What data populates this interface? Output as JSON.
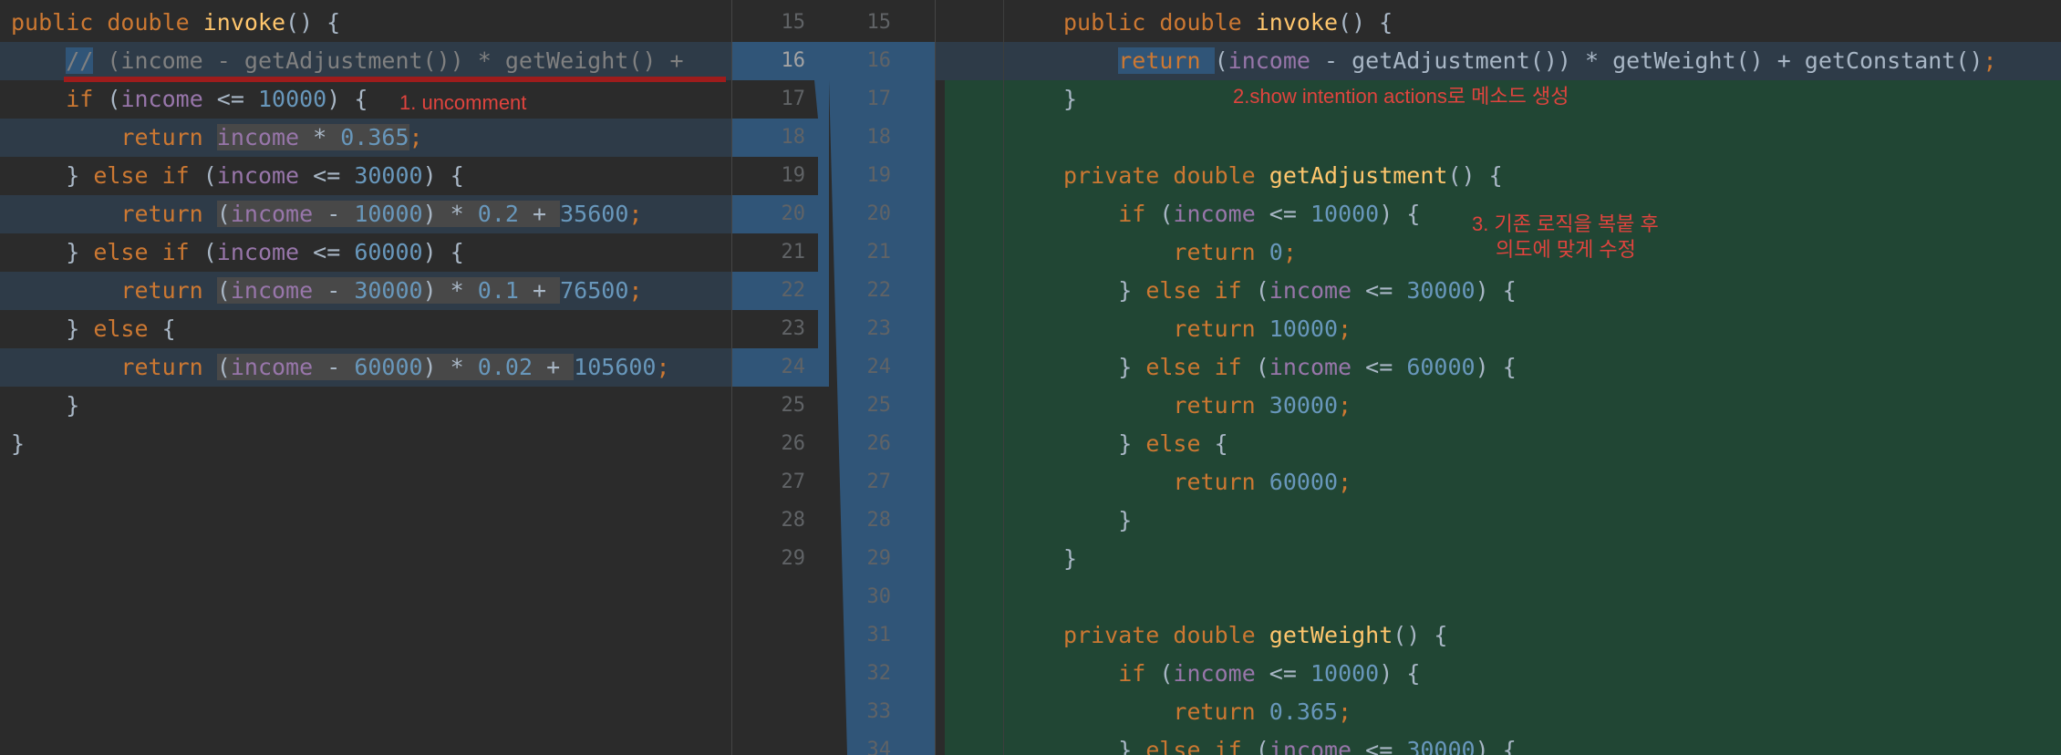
{
  "left": {
    "lines": [
      "public double invoke() {",
      "    // (income - getAdjustment()) * getWeight() +",
      "    if (income <= 10000) {",
      "        return income * 0.365;",
      "    } else if (income <= 30000) {",
      "        return (income - 10000) * 0.2 + 35600;",
      "    } else if (income <= 60000) {",
      "        return (income - 30000) * 0.1 + 76500;",
      "    } else {",
      "        return (income - 60000) * 0.02 + 105600;",
      "    }",
      "}"
    ]
  },
  "gutter": {
    "left_numbers": [
      "15",
      "16",
      "17",
      "18",
      "19",
      "20",
      "21",
      "22",
      "23",
      "24",
      "25",
      "26",
      "27",
      "28",
      "29"
    ],
    "right_numbers": [
      "15",
      "16",
      "17",
      "18",
      "19",
      "20",
      "21",
      "22",
      "23",
      "24",
      "25",
      "26",
      "27",
      "28",
      "29",
      "30",
      "31",
      "32",
      "33",
      "34"
    ]
  },
  "right": {
    "lines": [
      "public double invoke() {",
      "    return (income - getAdjustment()) * getWeight() + getConstant();",
      "}",
      "",
      "private double getAdjustment() {",
      "    if (income <= 10000) {",
      "        return 0;",
      "    } else if (income <= 30000) {",
      "        return 10000;",
      "    } else if (income <= 60000) {",
      "        return 30000;",
      "    } else {",
      "        return 60000;",
      "    }",
      "}",
      "",
      "private double getWeight() {",
      "    if (income <= 10000) {",
      "        return 0.365;",
      "    } else if (income <= 30000) {"
    ]
  },
  "annotations": {
    "step1": "1. uncomment",
    "step2": "2.show intention actions로 메소드 생성",
    "step3_line1": "3. 기존 로직을 복붙 후",
    "step3_line2": "의도에 맞게 수정"
  },
  "colors": {
    "background": "#2b2b2b",
    "changed_block": "#305578",
    "inserted_block": "#214634",
    "keyword": "#cc7832",
    "method": "#ffc66d",
    "field": "#9876aa",
    "number": "#6897bb",
    "annotation": "#e0443e"
  }
}
